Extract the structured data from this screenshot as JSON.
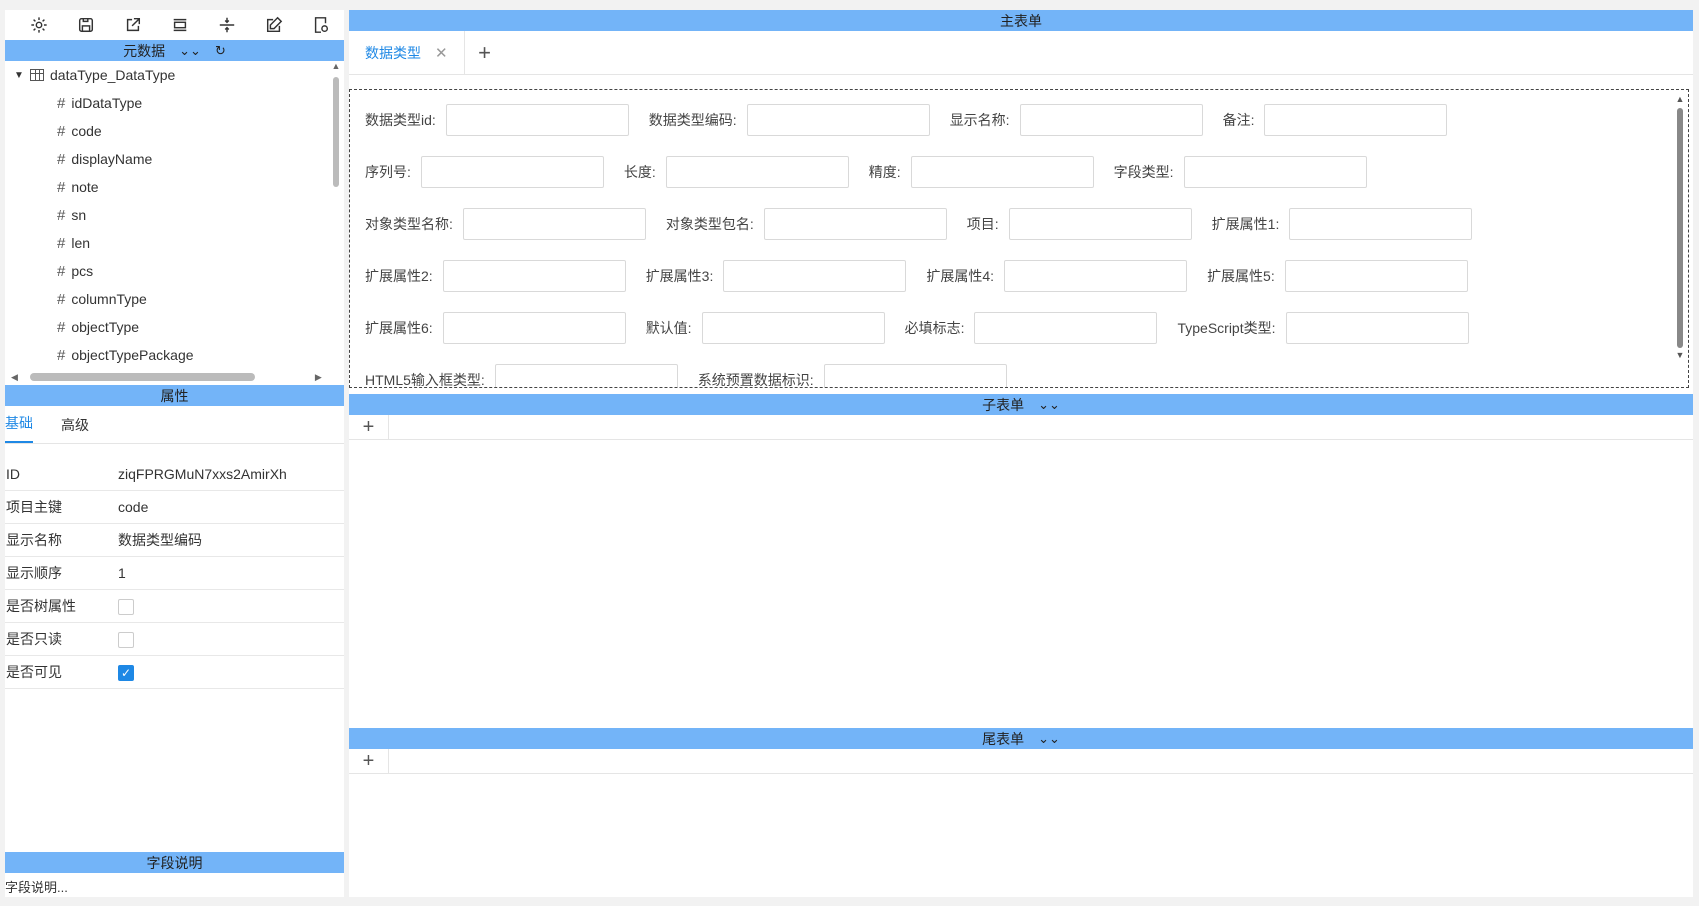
{
  "left": {
    "toolbar_icons": [
      "gear-icon",
      "save-icon",
      "export-icon",
      "layout-icon",
      "split-icon",
      "edit-icon",
      "doc-settings-icon"
    ],
    "metadata_title": "元数据",
    "tree": {
      "root": "dataType_DataType",
      "children": [
        "idDataType",
        "code",
        "displayName",
        "note",
        "sn",
        "len",
        "pcs",
        "columnType",
        "objectType",
        "objectTypePackage"
      ]
    },
    "props_title": "属性",
    "props_tabs": [
      "基础",
      "高级"
    ],
    "props": {
      "id_label": "ID",
      "id_value": "ziqFPRGMuN7xxs2AmirXh",
      "key_label": "项目主键",
      "key_value": "code",
      "name_label": "显示名称",
      "name_value": "数据类型编码",
      "order_label": "显示顺序",
      "order_value": "1",
      "tree_label": "是否树属性",
      "readonly_label": "是否只读",
      "visible_label": "是否可见"
    },
    "desc_title": "字段说明",
    "desc_text": "字段说明..."
  },
  "main": {
    "title": "主表单",
    "tab": "数据类型",
    "add": "+",
    "fields": {
      "r1": [
        "数据类型id:",
        "数据类型编码:",
        "显示名称:",
        "备注:"
      ],
      "r2": [
        "序列号:",
        "长度:",
        "精度:",
        "字段类型:"
      ],
      "r3": [
        "对象类型名称:",
        "对象类型包名:",
        "项目:",
        "扩展属性1:"
      ],
      "r4": [
        "扩展属性2:",
        "扩展属性3:",
        "扩展属性4:",
        "扩展属性5:"
      ],
      "r5": [
        "扩展属性6:",
        "默认值:",
        "必填标志:",
        "TypeScript类型:"
      ],
      "r6": [
        "HTML5输入框类型:",
        "系统预置数据标识:"
      ]
    }
  },
  "sub": {
    "title": "子表单",
    "add": "+"
  },
  "tail": {
    "title": "尾表单",
    "add": "+"
  }
}
